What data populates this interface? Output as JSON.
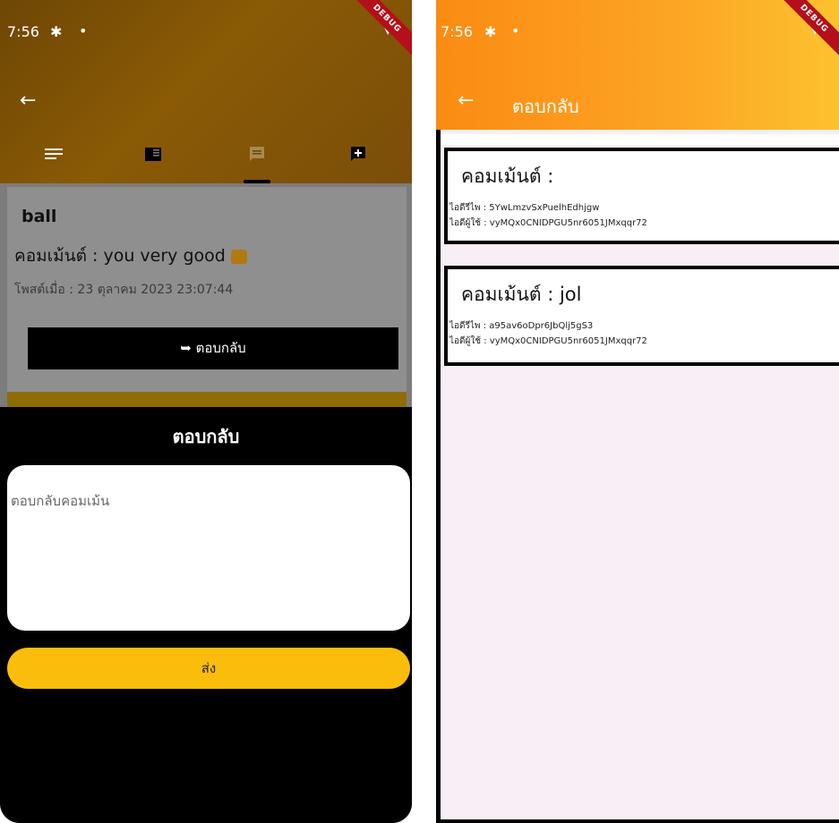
{
  "left": {
    "status": {
      "time": "7:56",
      "debug": "DEBUG"
    },
    "content": {
      "username": "ball",
      "comment": "คอมเม้นต์ : you very good",
      "posted": "โพสต์เมื่อ : 23 ตุลาคม 2023 23:07:44",
      "reply_button": "ตอบกลับ"
    },
    "sheet": {
      "title": "ตอบกลับ",
      "input_placeholder": "ตอบกลับคอมเม้น",
      "send_label": "ส่ง"
    }
  },
  "right": {
    "status": {
      "time": "7:56",
      "debug": "DEBUG"
    },
    "appbar": {
      "title": "ตอบกลับ"
    },
    "comments": [
      {
        "title": "คอมเม้นต์ :",
        "reply_id": "ไอดีรีไพ : 5YwLmzvSxPuelhEdhjgw",
        "user_id": "ไอดีผู้ใช้ : vyMQx0CNIDPGU5nr6051JMxqqr72"
      },
      {
        "title": "คอมเม้นต์ : jol",
        "reply_id": "ไอดีรีไพ : a95av6oDpr6JbQlj5gS3",
        "user_id": "ไอดีผู้ใช้ : vyMQx0CNIDPGU5nr6051JMxqqr72"
      }
    ]
  },
  "colors": {
    "send_button": "#fbbd0b",
    "right_appbar_start": "#fb8b12",
    "right_appbar_end": "#fcc22e",
    "debug_ribbon": "#b40f1a"
  }
}
